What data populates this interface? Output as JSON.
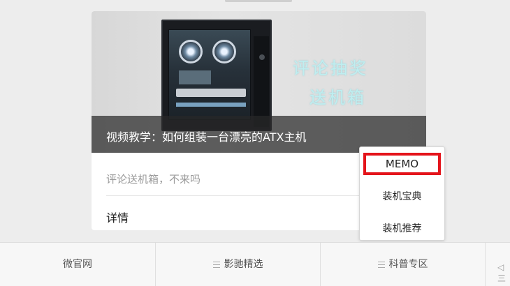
{
  "hero": {
    "overlay_line1": "评论抽奖",
    "overlay_line2": "送机箱",
    "caption": "视频教学：如何组装一台漂亮的ATX主机"
  },
  "card": {
    "description": "评论送机箱，不来吗",
    "details_label": "详情"
  },
  "popup_menu": {
    "items": [
      "MEMO",
      "装机宝典",
      "装机推荐"
    ],
    "highlight_color": "#e4141b"
  },
  "bottom_nav": {
    "tabs": [
      {
        "label": "微官网",
        "icon": ""
      },
      {
        "label": "影驰精选",
        "icon": "menu-icon"
      },
      {
        "label": "科普专区",
        "icon": "menu-icon"
      }
    ],
    "partial_tab_glyph": "◁三"
  }
}
